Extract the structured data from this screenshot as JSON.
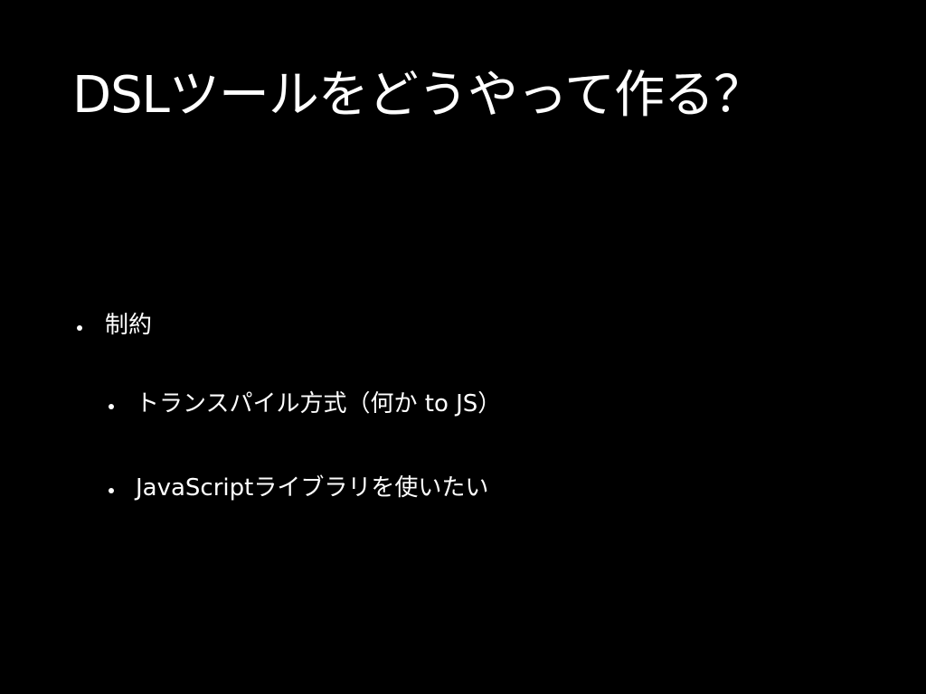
{
  "slide": {
    "title": "DSLツールをどうやって作る？",
    "bullets": {
      "constraints": "制約",
      "items": [
        "トランスパイル方式（何か to JS）",
        "JavaScriptライブラリを使いたい"
      ]
    }
  },
  "colors": {
    "background": "#000000",
    "text": "#ffffff"
  }
}
